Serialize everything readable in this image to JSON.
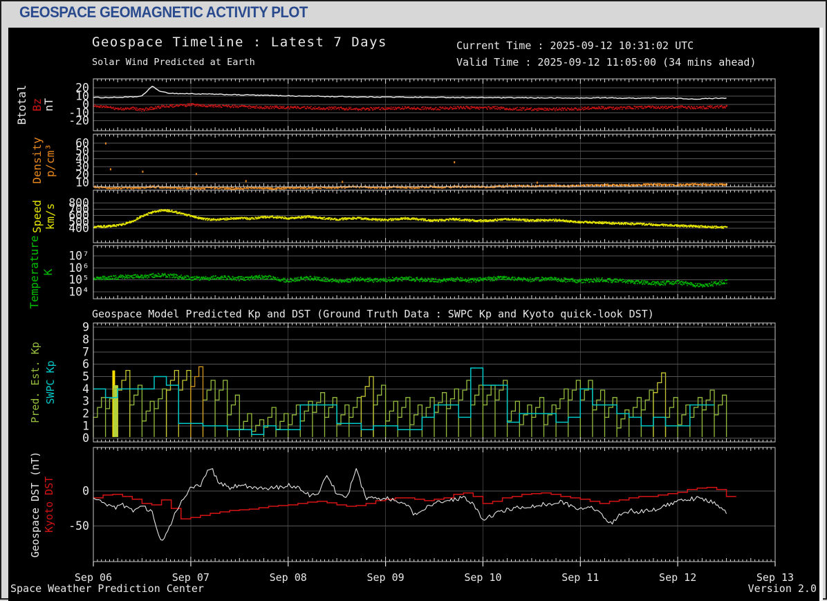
{
  "page": {
    "title": "GEOSPACE GEOMAGNETIC ACTIVITY PLOT"
  },
  "colors": {
    "header_text": "#2a4a8e",
    "page_bg": "#d7d7d7",
    "plot_bg": "#000000",
    "frame": "#c8c8c8",
    "hgrid": "#565656",
    "vgrid": "#3a3a3a",
    "tick": "#e0e0e0",
    "btotal": "#f0f0f0",
    "bz": "#cc1414",
    "density": "#e8881c",
    "speed": "#e6e600",
    "temperature": "#00b400",
    "pred_kp": "#96be3c",
    "pred_kp_mid": "#c8c832",
    "pred_kp_high": "#d2961e",
    "swpc_kp": "#00c8c8",
    "geospace_dst": "#e6e6e6",
    "kyoto_dst": "#d41414"
  },
  "chart_data": {
    "type": "line",
    "title": "Geospace Timeline : Latest 7 Days",
    "subtitle": "Solar Wind Predicted at Earth",
    "current_time": "Current Time : 2025-09-12 10:31:02 UTC",
    "valid_time": "Valid Time : 2025-09-12 11:05:00 (34 mins ahead)",
    "section2_title": "Geospace Model Predicted Kp and DST (Ground Truth Data : SWPC Kp and Kyoto quick-look DST)",
    "footer": {
      "left": "Space Weather Prediction Center",
      "right": "Version 2.0"
    },
    "x_axis": {
      "labels": [
        "Sep 06",
        "Sep 07",
        "Sep 08",
        "Sep 09",
        "Sep 10",
        "Sep 11",
        "Sep 12",
        "Sep 13"
      ],
      "days": 7,
      "minor_ticks_per_day": 24,
      "grid": true
    },
    "panels": [
      {
        "id": "bfield",
        "ylabels": [
          {
            "text": "Btotal",
            "color": "#e8e8e8"
          },
          {
            "text": "Bz",
            "color": "#cc1414"
          },
          {
            "text": "nT",
            "color": "#e8e8e8"
          }
        ],
        "yscale": {
          "type": "linear",
          "min": -32,
          "max": 31
        },
        "yticks": [
          {
            "v": 20,
            "t": "20"
          },
          {
            "v": 10,
            "t": "10"
          },
          {
            "v": 0,
            "t": "0"
          },
          {
            "v": -10,
            "t": "-10"
          },
          {
            "v": -20,
            "t": "-20"
          }
        ],
        "series": [
          {
            "name": "Btotal",
            "type": "line",
            "color": "#f0f0f0",
            "w": 1.4,
            "roughen": 0.5,
            "x0": 0,
            "dx": 0.1,
            "values": [
              8.5,
              8.3,
              8.4,
              8.6,
              9.0,
              10.0,
              22.0,
              15.0,
              13.5,
              13.0,
              13.0,
              12.5,
              12.5,
              12.0,
              12.0,
              11.5,
              11.5,
              11.0,
              11.0,
              10.5,
              10.5,
              10.0,
              10.0,
              10.0,
              9.5,
              9.5,
              9.5,
              9.0,
              9.0,
              9.0,
              9.0,
              8.8,
              8.8,
              8.6,
              8.6,
              8.5,
              8.5,
              8.4,
              8.3,
              8.3,
              8.2,
              8.2,
              8.0,
              8.0,
              8.0,
              8.0,
              7.8,
              7.8,
              7.7,
              7.6,
              7.6,
              7.8,
              8.0,
              7.8,
              7.6,
              7.5,
              7.6,
              7.8,
              7.6,
              7.4,
              7.2,
              6.8,
              6.5,
              7.0,
              7.5,
              7.8
            ]
          },
          {
            "name": "Bz",
            "type": "scatterline",
            "color": "#cc1414",
            "x0": 0,
            "dx": 0.1,
            "jitter": 1.7,
            "size": 1.6,
            "density": 1100,
            "values": [
              -0.5,
              -2,
              -4,
              -5,
              -4,
              -6,
              -4,
              -2,
              -1,
              -1,
              0,
              -0.5,
              -1,
              -1.5,
              -2,
              -2,
              -2.5,
              -3,
              -3,
              -3,
              -3,
              -3.5,
              -3.5,
              -4,
              -4,
              -4,
              -4.5,
              -5,
              -5,
              -4.5,
              -4,
              -4,
              -3.5,
              -4,
              -4,
              -4.5,
              -4,
              -3.5,
              -3,
              -3.5,
              -4,
              -3.5,
              -4,
              -4.5,
              -5,
              -5,
              -5.5,
              -5.5,
              -5,
              -5,
              -4.5,
              -4,
              -3.5,
              -4,
              -4,
              -3.5,
              -3,
              -2.5,
              -3,
              -3,
              -2.5,
              -3,
              -3.5,
              -3,
              -2.5,
              -2
            ]
          }
        ]
      },
      {
        "id": "density",
        "ylabels": [
          {
            "text": "Density",
            "color": "#e8881c"
          },
          {
            "text": "p/cm³",
            "color": "#e8881c"
          }
        ],
        "yscale": {
          "type": "linear",
          "min": 4.5,
          "max": 71.5
        },
        "yticks": [
          {
            "v": 60,
            "t": "60"
          },
          {
            "v": 50,
            "t": "50"
          },
          {
            "v": 40,
            "t": "40"
          },
          {
            "v": 30,
            "t": "30"
          },
          {
            "v": 20,
            "t": "20"
          },
          {
            "v": 10,
            "t": "10"
          }
        ],
        "series": [
          {
            "name": "Density",
            "type": "scatterline",
            "color": "#e8881c",
            "x0": 0,
            "dx": 0.1,
            "jitter": 1.2,
            "size": 1.6,
            "density": 1500,
            "values": [
              5,
              4,
              3.5,
              4,
              3.5,
              4,
              5,
              4.5,
              4,
              3.5,
              3.5,
              3,
              4,
              3.5,
              3,
              3,
              4,
              3.5,
              3,
              3,
              4,
              4,
              3.5,
              4,
              4,
              4,
              4.5,
              5,
              4.5,
              4,
              4,
              5,
              4.5,
              4,
              5,
              5,
              4.5,
              5,
              5,
              5,
              5,
              5,
              5.5,
              6,
              5.5,
              6,
              6,
              6.5,
              6,
              6,
              6.5,
              7,
              7,
              7.5,
              7,
              7,
              7.5,
              8,
              8,
              7.5,
              7.5,
              8,
              8.5,
              8,
              8,
              8
            ],
            "outliers": [
              {
                "d": 0.12,
                "v": 61
              },
              {
                "d": 0.17,
                "v": 28
              },
              {
                "d": 0.5,
                "v": 25
              },
              {
                "d": 1.05,
                "v": 22
              },
              {
                "d": 1.56,
                "v": 13
              },
              {
                "d": 2.55,
                "v": 12
              },
              {
                "d": 3.7,
                "v": 37
              },
              {
                "d": 4.55,
                "v": 11
              }
            ]
          }
        ]
      },
      {
        "id": "speed",
        "ylabels": [
          {
            "text": "Speed",
            "color": "#e6e600"
          },
          {
            "text": "km/s",
            "color": "#e6e600"
          }
        ],
        "yscale": {
          "type": "linear",
          "min": 170,
          "max": 1000
        },
        "yticks": [
          {
            "v": 800,
            "t": "800"
          },
          {
            "v": 700,
            "t": "700"
          },
          {
            "v": 600,
            "t": "600"
          },
          {
            "v": 500,
            "t": "500"
          },
          {
            "v": 400,
            "t": "400"
          }
        ],
        "series": [
          {
            "name": "Speed",
            "type": "scatterline",
            "color": "#e6e600",
            "x0": 0,
            "dx": 0.1,
            "jitter": 16,
            "size": 1.7,
            "density": 1500,
            "values": [
              430,
              435,
              445,
              470,
              520,
              600,
              660,
              690,
              680,
              640,
              600,
              560,
              545,
              550,
              560,
              570,
              560,
              575,
              590,
              580,
              565,
              575,
              590,
              575,
              560,
              550,
              560,
              570,
              555,
              545,
              540,
              550,
              565,
              555,
              540,
              530,
              540,
              550,
              540,
              530,
              525,
              535,
              545,
              550,
              540,
              530,
              535,
              540,
              530,
              515,
              505,
              500,
              495,
              490,
              485,
              480,
              475,
              468,
              462,
              455,
              448,
              442,
              436,
              430,
              425,
              420
            ]
          }
        ]
      },
      {
        "id": "temperature",
        "ylabels": [
          {
            "text": "Temperature",
            "color": "#00c000"
          },
          {
            "text": "K",
            "color": "#00c000"
          }
        ],
        "yscale": {
          "type": "log10",
          "min": 3.42,
          "max": 7.87
        },
        "yticks": [
          {
            "v": 7,
            "t": "10⁷"
          },
          {
            "v": 6,
            "t": "10⁶"
          },
          {
            "v": 5,
            "t": "10⁵"
          },
          {
            "v": 4,
            "t": "10⁴"
          }
        ],
        "series": [
          {
            "name": "Temperature",
            "type": "scatterline",
            "color": "#00b400",
            "x0": 0,
            "dx": 0.1,
            "jitter": 0.17,
            "size": 1.7,
            "density": 1400,
            "values": [
              5.1,
              5.2,
              5.25,
              5.3,
              5.35,
              5.3,
              5.4,
              5.45,
              5.4,
              5.3,
              5.2,
              5.15,
              5.2,
              5.25,
              5.2,
              5.15,
              5.2,
              5.3,
              5.25,
              5.1,
              5.0,
              5.1,
              5.2,
              5.15,
              5.05,
              4.95,
              5.0,
              5.1,
              5.05,
              5.0,
              5.05,
              5.1,
              5.15,
              5.1,
              5.05,
              5.0,
              5.05,
              5.1,
              5.05,
              5.0,
              5.1,
              5.15,
              5.2,
              5.15,
              5.1,
              5.05,
              5.1,
              5.1,
              5.05,
              5.0,
              4.95,
              5.0,
              5.05,
              5.0,
              4.95,
              4.9,
              4.85,
              4.8,
              4.75,
              4.8,
              4.85,
              4.7,
              4.6,
              4.65,
              4.75,
              4.9
            ]
          }
        ]
      },
      {
        "id": "kp",
        "ylabels": [
          {
            "text": "Pred. Est. Kp",
            "color": "#96be3c"
          },
          {
            "text": "SWPC Kp",
            "color": "#00c8c8"
          }
        ],
        "yscale": {
          "type": "linear",
          "min": -0.3,
          "max": 9.35
        },
        "yticks": [
          {
            "v": 9,
            "t": "9"
          },
          {
            "v": 8,
            "t": "8"
          },
          {
            "v": 7,
            "t": "7"
          },
          {
            "v": 6,
            "t": "6"
          },
          {
            "v": 5,
            "t": "5"
          },
          {
            "v": 4,
            "t": "4"
          },
          {
            "v": 3,
            "t": "3"
          },
          {
            "v": 2,
            "t": "2"
          },
          {
            "v": 1,
            "t": "1"
          },
          {
            "v": 0,
            "t": "0"
          }
        ],
        "highlights": [
          {
            "d": 0.195,
            "w": 0.028,
            "kp": 5.5,
            "color": "#ffe000"
          },
          {
            "d": 0.205,
            "w": 0.05,
            "kp": 4.3,
            "color": "#b4d23c"
          }
        ],
        "series": [
          {
            "name": "Pred. Est. Kp",
            "type": "kp_ramps",
            "dt": 0.125,
            "color_low": "#96be3c",
            "color_mid": "#c8c832",
            "color_high": "#d2961e",
            "peaks": [
              3.3,
              4.0,
              5.5,
              4.3,
              3.0,
              4.0,
              5.5,
              5.5,
              5.8,
              4.7,
              4.7,
              3.5,
              2.0,
              1.5,
              2.5,
              2.0,
              2.7,
              3.0,
              3.7,
              3.3,
              2.7,
              3.3,
              5.0,
              4.3,
              3.0,
              3.3,
              2.7,
              3.3,
              3.7,
              4.0,
              4.7,
              4.3,
              4.3,
              4.7,
              3.0,
              2.7,
              3.3,
              2.7,
              4.0,
              4.7,
              4.7,
              3.9,
              3.3,
              2.3,
              3.3,
              3.9,
              5.3,
              3.3,
              2.7,
              3.3,
              3.9,
              3.5
            ]
          },
          {
            "name": "SWPC Kp",
            "type": "steps",
            "color": "#00c8c8",
            "w": 1.5,
            "dt": 0.125,
            "values": [
              4,
              3.3,
              4,
              4,
              4,
              5,
              4.3,
              1.2,
              1.2,
              1,
              1,
              0.7,
              0.7,
              0.3,
              1,
              0.7,
              0.7,
              2.7,
              2.7,
              2.7,
              1.2,
              1.2,
              0.7,
              1,
              1,
              0.7,
              0.7,
              1.7,
              2.7,
              2.7,
              1.7,
              5.7,
              4.3,
              4.3,
              1.3,
              2,
              2,
              2,
              1.3,
              1.7,
              4,
              2.7,
              2.7,
              2,
              1.7,
              1,
              1.7,
              1,
              1,
              2.7,
              2.7
            ]
          }
        ]
      },
      {
        "id": "dst",
        "ylabels": [
          {
            "text": "Geospace DST (nT)",
            "color": "#e8e8e8"
          },
          {
            "text": "Kyoto DST",
            "color": "#d41414"
          }
        ],
        "yscale": {
          "type": "linear",
          "min": -101,
          "max": 62
        },
        "yticks": [
          {
            "v": 0,
            "t": "0"
          },
          {
            "v": -50,
            "t": "-50"
          }
        ],
        "series": [
          {
            "name": "Kyoto DST",
            "type": "steps",
            "color": "#d41414",
            "w": 1.5,
            "dt": 0.1,
            "values": [
              -10,
              -6,
              -5,
              -8,
              -12,
              -18,
              -20,
              -13,
              -25,
              -40,
              -38,
              -35,
              -32,
              -30,
              -28,
              -27,
              -26,
              -24,
              -22,
              -21,
              -20,
              -18,
              -16,
              -15,
              -17,
              -20,
              -22,
              -21,
              -18,
              -14,
              -12,
              -10,
              -10,
              -12,
              -14,
              -12,
              -10,
              -5,
              -3,
              -8,
              -18,
              -15,
              -10,
              -8,
              -5,
              -4,
              -3,
              -5,
              -8,
              -10,
              -12,
              -15,
              -18,
              -15,
              -13,
              -10,
              -8,
              -8,
              -6,
              -4,
              -2,
              2,
              4,
              5,
              2,
              -8
            ]
          },
          {
            "name": "Geospace DST",
            "type": "line",
            "color": "#e6e6e6",
            "w": 1.1,
            "roughen": 3.2,
            "x0": 0,
            "dx": 0.1,
            "values": [
              -10,
              -18,
              -25,
              -20,
              -28,
              -22,
              -30,
              -75,
              -45,
              -15,
              5,
              8,
              35,
              10,
              5,
              8,
              6,
              5,
              4,
              5,
              8,
              6,
              -5,
              -8,
              25,
              -5,
              -10,
              30,
              -10,
              -12,
              -10,
              -13,
              -16,
              -35,
              -25,
              -18,
              -15,
              -12,
              -10,
              -20,
              -42,
              -35,
              -28,
              -25,
              -24,
              -22,
              -20,
              -18,
              -15,
              -22,
              -25,
              -22,
              -30,
              -48,
              -35,
              -28,
              -30,
              -28,
              -25,
              -20,
              -16,
              -13,
              -10,
              -14,
              -18,
              -31
            ]
          }
        ]
      }
    ]
  }
}
